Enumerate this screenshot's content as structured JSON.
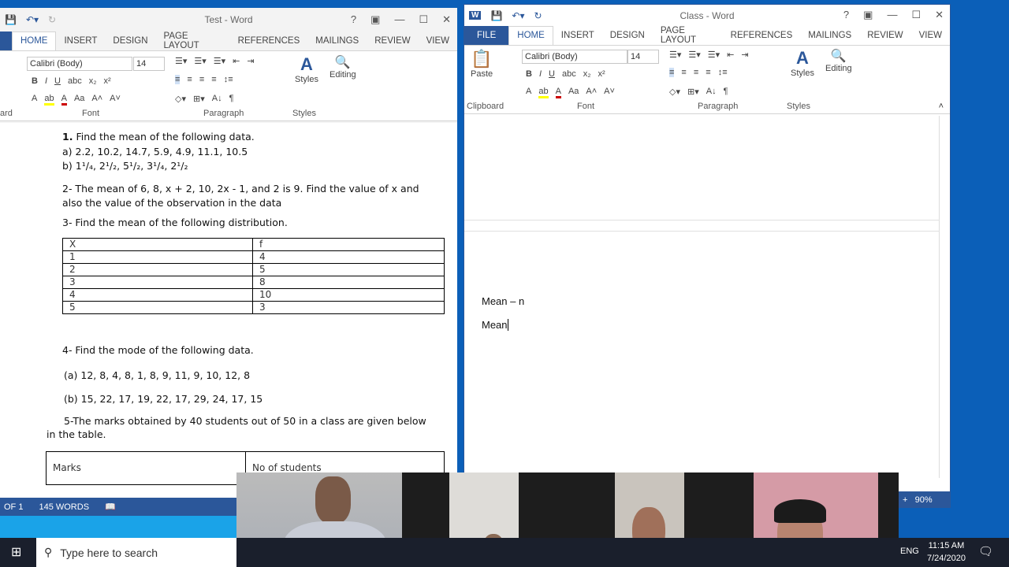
{
  "left_window": {
    "title": "Test - Word",
    "tabs": [
      "HOME",
      "INSERT",
      "DESIGN",
      "PAGE LAYOUT",
      "REFERENCES",
      "MAILINGS",
      "REVIEW",
      "VIEW"
    ],
    "font": "Calibri (Body)",
    "size": "14",
    "groups": [
      "ard",
      "Font",
      "Paragraph",
      "Styles"
    ],
    "styles_label": "Styles",
    "editing_label": "Editing",
    "doc": {
      "q1": "1.",
      "q1_text": "Find the mean of the following data.",
      "q1a": "a)  2.2, 10.2, 14.7, 5.9, 4.9, 11.1, 10.5",
      "q1b": "b)  1¹/₄, 2¹/₂, 5¹/₂, 3¹/₄, 2¹/₂",
      "q2_line1": "2- The mean of 6, 8, x + 2, 10, 2x - 1, and 2 is 9. Find the value of x and",
      "q2_line2": "also the value of the observation in the data",
      "q3": "3- Find the mean of the following distribution.",
      "table": {
        "headers": [
          "X",
          "f"
        ],
        "rows": [
          [
            "1",
            "4"
          ],
          [
            "2",
            "5"
          ],
          [
            "3",
            "8"
          ],
          [
            "4",
            "10"
          ],
          [
            "5",
            "3"
          ]
        ]
      },
      "q4": "4- Find the mode of the following data.",
      "q4a": "(a) 12, 8, 4, 8, 1, 8, 9, 11, 9, 10, 12, 8",
      "q4b": "(b) 15, 22, 17, 19, 22, 17, 29, 24, 17, 15",
      "q5_line1": "5-The marks obtained by 40 students out of 50 in a class are given below",
      "q5_line2": "in the table.",
      "table2_headers": [
        "Marks",
        "No of students"
      ]
    },
    "status": {
      "page": "OF 1",
      "words": "145 WORDS"
    }
  },
  "right_window": {
    "title": "Class - Word",
    "tabs": [
      "FILE",
      "HOME",
      "INSERT",
      "DESIGN",
      "PAGE LAYOUT",
      "REFERENCES",
      "MAILINGS",
      "REVIEW",
      "VIEW"
    ],
    "font": "Calibri (Body)",
    "size": "14",
    "paste_label": "Paste",
    "groups": [
      "Clipboard",
      "Font",
      "Paragraph",
      "Styles"
    ],
    "styles_label": "Styles",
    "editing_label": "Editing",
    "doc": {
      "line1": "Mean – n",
      "line2": "Mean "
    },
    "zoom": "90%"
  },
  "taskbar": {
    "search_placeholder": "Type here to search",
    "lang": "ENG",
    "time": "11:15 AM",
    "date": "7/24/2020"
  }
}
